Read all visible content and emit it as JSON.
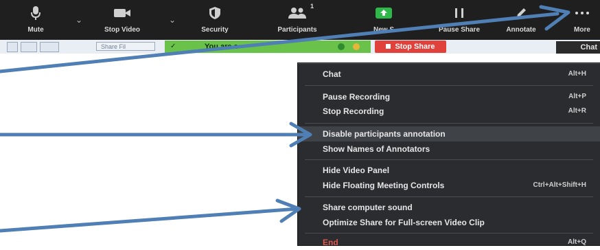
{
  "toolbar": {
    "mute": "Mute",
    "stop_video": "Stop Video",
    "security": "Security",
    "participants": "Participants",
    "participant_count": "1",
    "new_share": "New S",
    "pause_share": "Pause Share",
    "annotate": "Annotate",
    "more": "More"
  },
  "share_bar": {
    "share_file": "Share Fil",
    "status_text": "You are s",
    "stop_share": "Stop Share",
    "chat_tab": "Chat"
  },
  "menu": {
    "chat": {
      "label": "Chat",
      "shortcut": "Alt+H"
    },
    "pause_recording": {
      "label": "Pause Recording",
      "shortcut": "Alt+P"
    },
    "stop_recording": {
      "label": "Stop Recording",
      "shortcut": "Alt+R"
    },
    "disable_annotation": {
      "label": "Disable participants annotation"
    },
    "show_names": {
      "label": "Show Names of Annotators"
    },
    "hide_video_panel": {
      "label": "Hide Video Panel"
    },
    "hide_floating": {
      "label": "Hide Floating Meeting Controls",
      "shortcut": "Ctrl+Alt+Shift+H"
    },
    "share_sound": {
      "label": "Share computer sound"
    },
    "optimize_share": {
      "label": "Optimize Share for Full-screen Video Clip"
    },
    "end": {
      "label": "End",
      "shortcut": "Alt+Q"
    }
  },
  "colors": {
    "toolbar_bg": "#1f1f1f",
    "menu_bg": "#2a2c30",
    "green_status": "#6ac24a",
    "stop_red": "#e0413b",
    "arrow_blue": "#4f7fb5"
  }
}
